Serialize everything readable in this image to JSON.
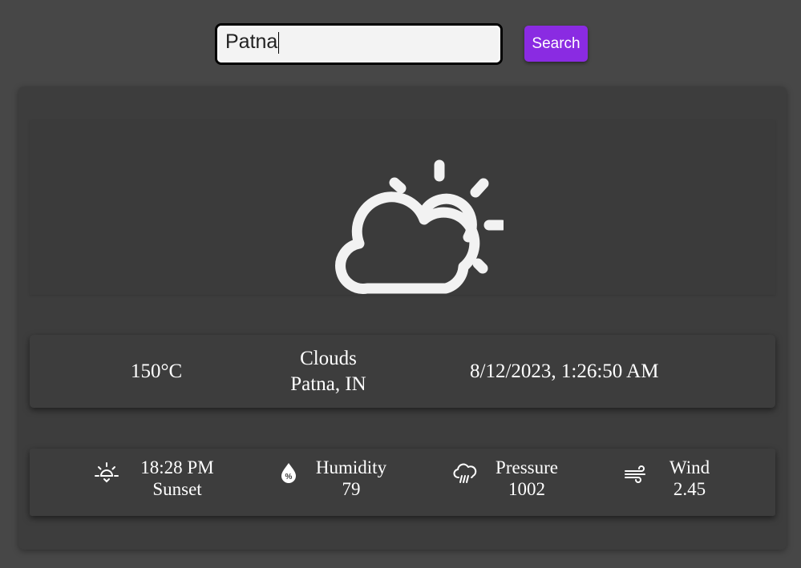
{
  "search": {
    "value": "Patna",
    "button_label": "Search"
  },
  "weather": {
    "icon": "partly-cloudy-icon",
    "temperature": "150°C",
    "condition": "Clouds",
    "location": "Patna, IN",
    "datetime": "8/12/2023, 1:26:50 AM"
  },
  "details": {
    "sunset": {
      "icon": "sunset-icon",
      "value": "18:28 PM",
      "label": "Sunset"
    },
    "humidity": {
      "icon": "humidity-icon",
      "label": "Humidity",
      "value": "79"
    },
    "pressure": {
      "icon": "pressure-icon",
      "label": "Pressure",
      "value": "1002"
    },
    "wind": {
      "icon": "wind-icon",
      "label": "Wind",
      "value": "2.45"
    }
  },
  "colors": {
    "page_background": "#474747",
    "card_background": "#3d3d3d",
    "accent": "#8a2be2",
    "text": "#ffffff"
  }
}
